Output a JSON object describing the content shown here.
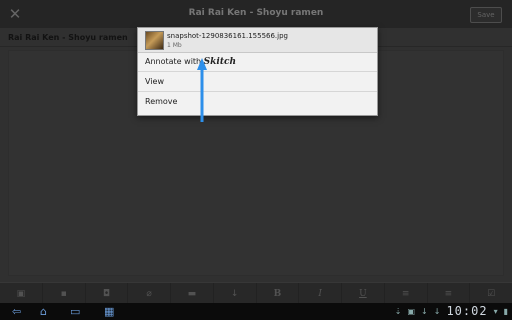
{
  "app": {
    "title": "Rai Rai Ken - Shoyu ramen",
    "save_label": "Save",
    "note_title": "Rai Rai Ken - Shoyu ramen"
  },
  "toolbar": {
    "buttons": [
      {
        "name": "snapshot-icon",
        "glyph": "▣"
      },
      {
        "name": "image-icon",
        "glyph": "▪"
      },
      {
        "name": "lock-icon",
        "glyph": "🔒"
      },
      {
        "name": "attach-icon",
        "glyph": "⌀"
      },
      {
        "name": "camera-icon",
        "glyph": "▬"
      },
      {
        "name": "mic-icon",
        "glyph": "↓"
      },
      {
        "name": "bold-button",
        "glyph": "B"
      },
      {
        "name": "italic-button",
        "glyph": "I"
      },
      {
        "name": "underline-button",
        "glyph": "U"
      },
      {
        "name": "bullet-list-button",
        "glyph": "≡"
      },
      {
        "name": "numbered-list-button",
        "glyph": "≡"
      },
      {
        "name": "checkbox-button",
        "glyph": "☑"
      }
    ]
  },
  "dialog": {
    "filename": "snapshot-1290836161.155566.jpg",
    "filesize": "1 Mb",
    "items": [
      {
        "label": "Annotate with",
        "brand": "Skitch"
      },
      {
        "label": "View"
      },
      {
        "label": "Remove"
      }
    ]
  },
  "statusbar": {
    "time": "10:02"
  },
  "colors": {
    "accent_arrow": "#2d8fea",
    "dialog_bg": "#f2f2f2",
    "nav_icons": "#6a9bd8"
  }
}
